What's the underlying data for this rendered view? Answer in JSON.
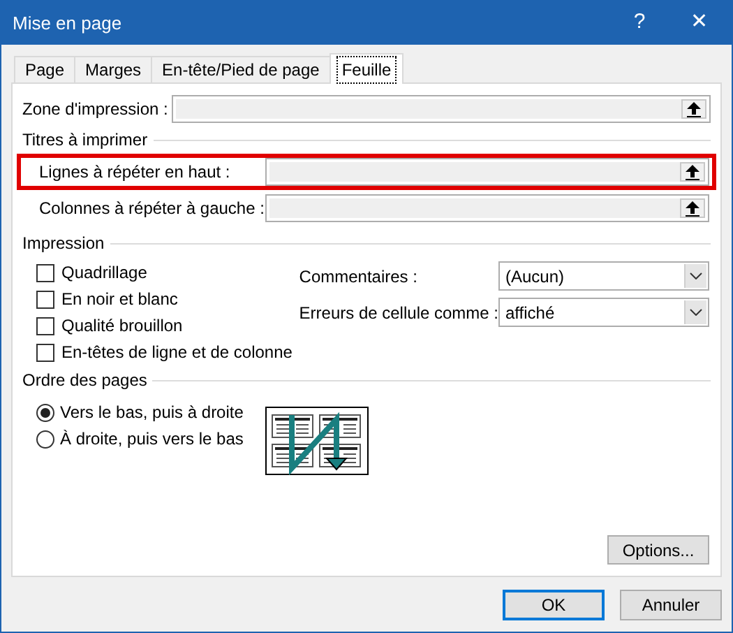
{
  "window": {
    "title": "Mise en page",
    "help": "?",
    "close": "✕"
  },
  "tabs": [
    {
      "label": "Page",
      "selected": false
    },
    {
      "label": "Marges",
      "selected": false
    },
    {
      "label": "En-tête/Pied de page",
      "selected": false
    },
    {
      "label": "Feuille",
      "selected": true
    }
  ],
  "print_area": {
    "label": "Zone d'impression :"
  },
  "print_titles": {
    "heading": "Titres à imprimer",
    "fields": [
      {
        "label": "Lignes à répéter en haut :",
        "highlighted": true
      },
      {
        "label": "Colonnes à répéter à gauche :",
        "highlighted": false
      }
    ]
  },
  "print": {
    "heading": "Impression",
    "checkboxes": [
      {
        "label": "Quadrillage",
        "checked": false
      },
      {
        "label": "En noir et blanc",
        "checked": false
      },
      {
        "label": "Qualité brouillon",
        "checked": false
      },
      {
        "label": "En-têtes de ligne et de colonne",
        "checked": false
      }
    ],
    "dropdowns": [
      {
        "label": "Commentaires :",
        "value": "(Aucun)"
      },
      {
        "label": "Erreurs de cellule comme :",
        "value": "affiché"
      }
    ]
  },
  "page_order": {
    "heading": "Ordre des pages",
    "options": [
      {
        "label": "Vers le bas, puis à droite",
        "selected": true
      },
      {
        "label": "À droite, puis vers le bas",
        "selected": false
      }
    ]
  },
  "buttons": {
    "options": "Options...",
    "ok": "OK",
    "cancel": "Annuler"
  }
}
